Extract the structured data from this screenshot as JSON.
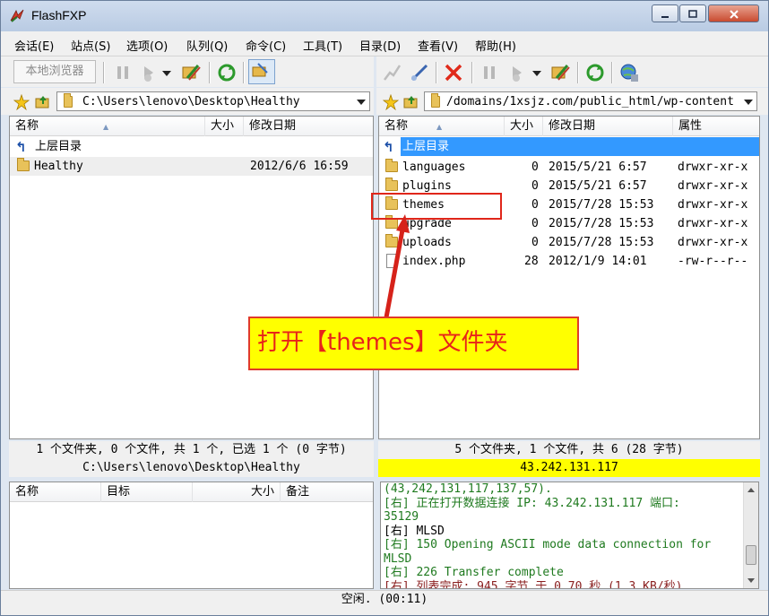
{
  "window": {
    "title": "FlashFXP",
    "controls": [
      "0",
      "1",
      "r"
    ]
  },
  "menu": [
    "会话(E)",
    "站点(S)",
    "选项(O)",
    "队列(Q)",
    "命令(C)",
    "工具(T)",
    "目录(D)",
    "查看(V)",
    "帮助(H)"
  ],
  "left": {
    "toolbar": {
      "local_browser": "本地浏览器"
    },
    "path": "C:\\Users\\lenovo\\Desktop\\Healthy",
    "columns": {
      "name": "名称",
      "size": "大小",
      "date": "修改日期"
    },
    "rows": [
      {
        "name": "上层目录",
        "size": "",
        "date": "",
        "type": "up"
      },
      {
        "name": "Healthy",
        "size": "",
        "date": "2012/6/6 16:59",
        "type": "folder"
      }
    ],
    "status": "1 个文件夹, 0 个文件, 共 1 个, 已选 1 个 (0 字节)",
    "status_path": "C:\\Users\\lenovo\\Desktop\\Healthy"
  },
  "right": {
    "path": "/domains/1xsjz.com/public_html/wp-content",
    "columns": {
      "name": "名称",
      "size": "大小",
      "date": "修改日期",
      "attr": "属性"
    },
    "rows": [
      {
        "name": "上层目录",
        "size": "",
        "date": "",
        "attr": "",
        "type": "up"
      },
      {
        "name": "languages",
        "size": "0",
        "date": "2015/5/21 6:57",
        "attr": "drwxr-xr-x",
        "type": "folder"
      },
      {
        "name": "plugins",
        "size": "0",
        "date": "2015/5/21 6:57",
        "attr": "drwxr-xr-x",
        "type": "folder"
      },
      {
        "name": "themes",
        "size": "0",
        "date": "2015/7/28 15:53",
        "attr": "drwxr-xr-x",
        "type": "folder"
      },
      {
        "name": "upgrade",
        "size": "0",
        "date": "2015/7/28 15:53",
        "attr": "drwxr-xr-x",
        "type": "folder"
      },
      {
        "name": "uploads",
        "size": "0",
        "date": "2015/7/28 15:53",
        "attr": "drwxr-xr-x",
        "type": "folder"
      },
      {
        "name": "index.php",
        "size": "28",
        "date": "2012/1/9 14:01",
        "attr": "-rw-r--r--",
        "type": "file"
      }
    ],
    "status": "5 个文件夹, 1 个文件, 共 6 (28 字节)",
    "status_ip": "43.242.131.117"
  },
  "queue": {
    "columns": {
      "name": "名称",
      "target": "目标",
      "size": "大小",
      "note": "备注"
    }
  },
  "log": [
    {
      "text": "(43,242,131,117,137,57).",
      "color": "#1f7a1f"
    },
    {
      "text": "[右] 正在打开数据连接 IP: 43.242.131.117 端口:",
      "color": "#1f7a1f"
    },
    {
      "text": "35129",
      "color": "#1f7a1f"
    },
    {
      "text": "[右] MLSD",
      "color": "#000000"
    },
    {
      "text": "[右] 150 Opening ASCII mode data connection for",
      "color": "#1f7a1f"
    },
    {
      "text": "MLSD",
      "color": "#1f7a1f"
    },
    {
      "text": "[右] 226 Transfer complete",
      "color": "#1f7a1f"
    },
    {
      "text": "[右] 列表完成: 945 字节 于 0.70 秒 (1.3 KB/秒)",
      "color": "#8a1f1f"
    }
  ],
  "bottom_status": "空闲. (00:11)",
  "annotation": "打开【themes】文件夹",
  "colors": {
    "selection": "#3399ff",
    "status_ip_bg": "#ffff00",
    "annot_bg": "#ffff00",
    "annot_text": "#e8231a"
  }
}
